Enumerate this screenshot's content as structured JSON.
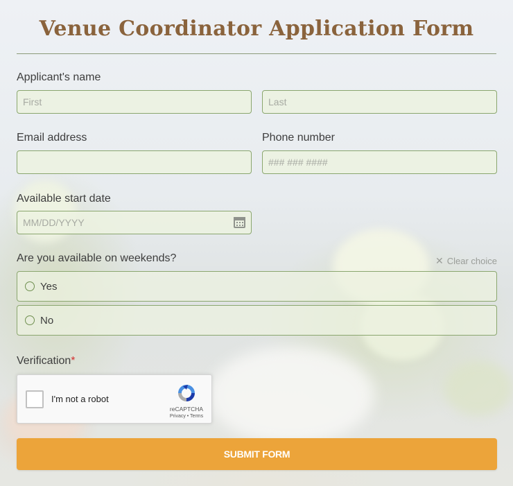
{
  "title": "Venue Coordinator Application Form",
  "name": {
    "label": "Applicant's name",
    "first_placeholder": "First",
    "last_placeholder": "Last"
  },
  "email": {
    "label": "Email address",
    "placeholder": ""
  },
  "phone": {
    "label": "Phone number",
    "placeholder": "### ### ####"
  },
  "start_date": {
    "label": "Available start date",
    "placeholder": "MM/DD/YYYY",
    "icon": "calendar-icon"
  },
  "weekends": {
    "label": "Are you available on weekends?",
    "clear_label": "Clear choice",
    "clear_icon": "close-icon",
    "options": [
      {
        "label": "Yes"
      },
      {
        "label": "No"
      }
    ]
  },
  "verification": {
    "label": "Verification",
    "required_mark": "*",
    "captcha_text": "I'm not a robot",
    "captcha_brand": "reCAPTCHA",
    "captcha_links": "Privacy • Terms"
  },
  "submit_label": "SUBMIT FORM",
  "colors": {
    "title": "#8a633c",
    "accent": "#eca43a",
    "field_border": "#8aa66e",
    "required": "#d32f2f"
  }
}
